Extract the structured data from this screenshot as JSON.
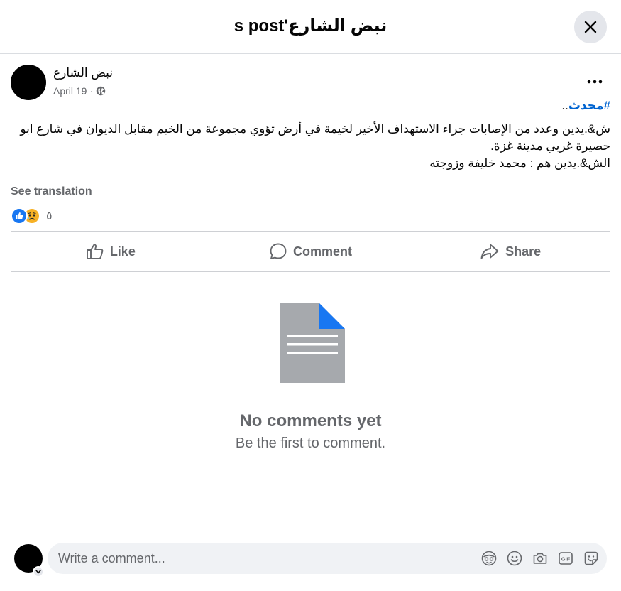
{
  "header": {
    "title": "نبض الشارع's post",
    "close_icon": "close-icon"
  },
  "post": {
    "author": "نبض الشارع",
    "date": "April 19",
    "audience_icon": "globe-icon",
    "hashtag": "#محدث",
    "hashtag_suffix": "..",
    "body_lines": [
      "ش&.يدين وعدد من الإصابات جراء الاستهداف الأخير لخيمة في أرض تؤوي مجموعة من الخيم مقابل الديوان في شارع ابو حصيرة غربي مدينة غزة.",
      "الش&.يدين هم : محمد خليفة وزوجته"
    ],
    "see_translation": "See translation",
    "reaction_count": "٥",
    "reaction_icons": [
      "like-icon",
      "sad-icon"
    ]
  },
  "actions": {
    "like": "Like",
    "comment": "Comment",
    "share": "Share"
  },
  "empty": {
    "title": "No comments yet",
    "subtitle": "Be the first to comment."
  },
  "composer": {
    "placeholder": "Write a comment..."
  },
  "colors": {
    "accent": "#1877f2",
    "hashtag": "#0064d1",
    "secondary_text": "#65676b",
    "doc_gray": "#a6a9ad",
    "sad_yellow": "#f7b125"
  }
}
